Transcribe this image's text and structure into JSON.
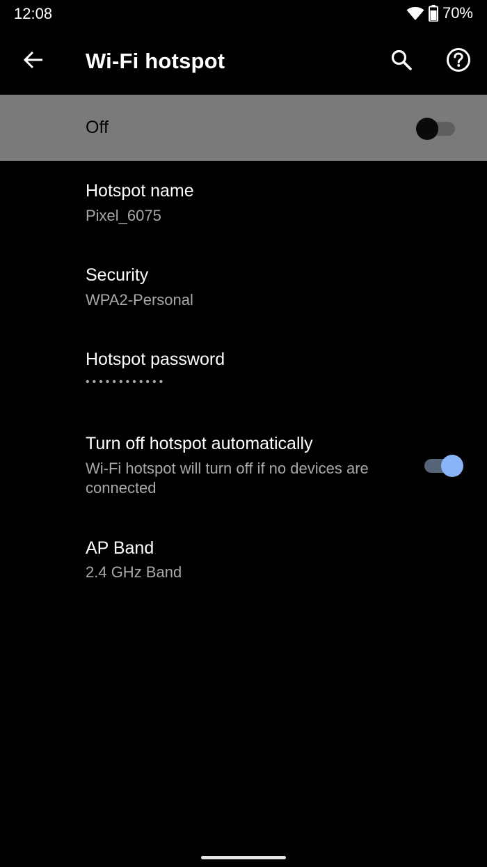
{
  "status_bar": {
    "time": "12:08",
    "battery_percent": "70%",
    "icons": [
      "wifi-icon",
      "battery-icon"
    ]
  },
  "app_bar": {
    "title": "Wi-Fi hotspot",
    "icons": [
      "back-arrow-icon",
      "search-icon",
      "help-icon"
    ]
  },
  "master_switch": {
    "label": "Off",
    "checked": false
  },
  "preferences": [
    {
      "title": "Hotspot name",
      "summary": "Pixel_6075"
    },
    {
      "title": "Security",
      "summary": "WPA2-Personal"
    },
    {
      "title": "Hotspot password",
      "summary": "••••••••••••"
    },
    {
      "title": "Turn off hotspot automatically",
      "summary": "Wi-Fi hotspot will turn off if no devices are connected",
      "checked": true
    },
    {
      "title": "AP Band",
      "summary": "2.4 GHz Band"
    }
  ],
  "colors": {
    "background": "#000000",
    "master_bar": "#7a7a7a",
    "accent": "#8ab4f8",
    "secondary_text": "#a9a9a9"
  }
}
